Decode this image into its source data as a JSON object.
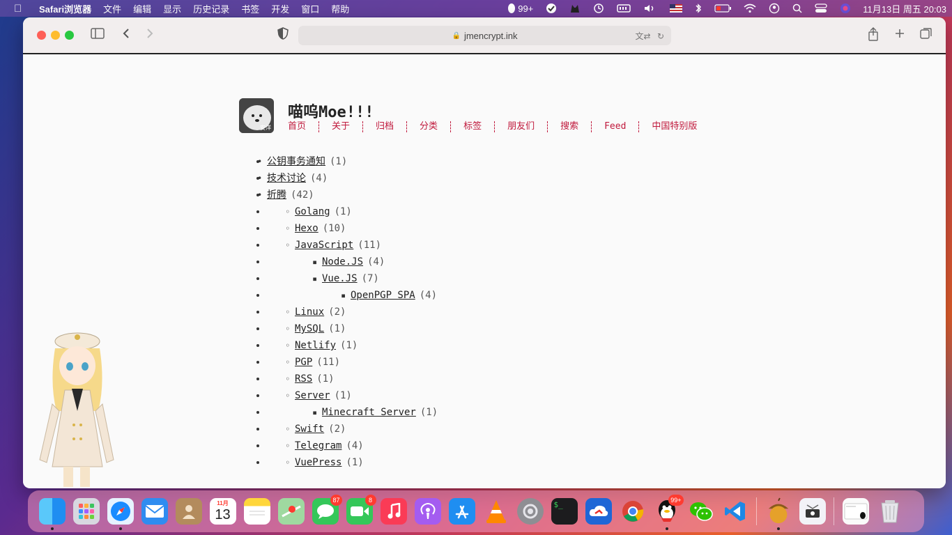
{
  "menubar": {
    "app_name": "Safari浏览器",
    "items": [
      "文件",
      "编辑",
      "显示",
      "历史记录",
      "书签",
      "开发",
      "窗口",
      "帮助"
    ],
    "qq_count": "99+",
    "datetime": "11月13日 周五  20:03"
  },
  "browser": {
    "url": "jmencrypt.ink"
  },
  "site": {
    "title": "喵呜Moe!!!",
    "avatar_caption": "安洋",
    "nav": [
      "首页",
      "关于",
      "归档",
      "分类",
      "标签",
      "朋友们",
      "搜索",
      "Feed",
      "中国特别版"
    ]
  },
  "categories": [
    {
      "level": 1,
      "name": "公钥事务通知",
      "count": "(1)"
    },
    {
      "level": 1,
      "name": "技术讨论",
      "count": "(4)"
    },
    {
      "level": 1,
      "name": "折腾",
      "count": "(42)"
    },
    {
      "level": 2,
      "name": "Golang",
      "count": "(1)"
    },
    {
      "level": 2,
      "name": "Hexo",
      "count": "(10)"
    },
    {
      "level": 2,
      "name": "JavaScript",
      "count": "(11)"
    },
    {
      "level": 3,
      "name": "Node.JS",
      "count": "(4)"
    },
    {
      "level": 3,
      "name": "Vue.JS",
      "count": "(7)"
    },
    {
      "level": 4,
      "name": "OpenPGP SPA",
      "count": "(4)"
    },
    {
      "level": 2,
      "name": "Linux",
      "count": "(2)"
    },
    {
      "level": 2,
      "name": "MySQL",
      "count": "(1)"
    },
    {
      "level": 2,
      "name": "Netlify",
      "count": "(1)"
    },
    {
      "level": 2,
      "name": "PGP",
      "count": "(11)"
    },
    {
      "level": 2,
      "name": "RSS",
      "count": "(1)"
    },
    {
      "level": 2,
      "name": "Server",
      "count": "(1)"
    },
    {
      "level": 3,
      "name": "Minecraft Server",
      "count": "(1)"
    },
    {
      "level": 2,
      "name": "Swift",
      "count": "(2)"
    },
    {
      "level": 2,
      "name": "Telegram",
      "count": "(4)"
    },
    {
      "level": 2,
      "name": "VuePress",
      "count": "(1)"
    }
  ],
  "dock": {
    "calendar_month": "11月",
    "calendar_day": "13",
    "messages_badge": "87",
    "facetime_badge": "8",
    "qq_badge": "99+",
    "terminal_label": "$_"
  },
  "colors": {
    "link_red": "#c0193c",
    "window_bg": "#fafafa",
    "toolbar_bg": "#f2eeee"
  }
}
